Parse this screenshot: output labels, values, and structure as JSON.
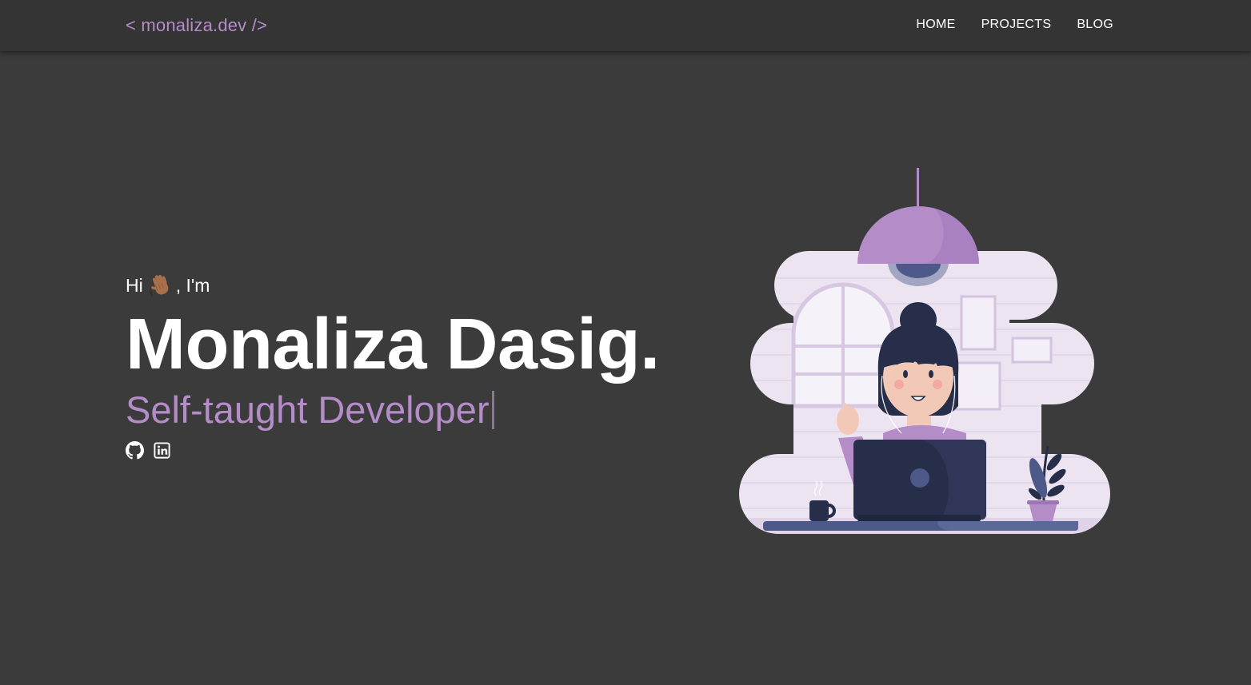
{
  "nav": {
    "brand": "< monaliza.dev />",
    "links": [
      "HOME",
      "PROJECTS",
      "BLOG"
    ]
  },
  "hero": {
    "greeting_prefix": "Hi",
    "greeting_suffix": ", I'm",
    "name": "Monaliza Dasig.",
    "subtitle": "Self-taught Developer"
  },
  "icons": {
    "wave": "waving-hand-emoji",
    "github": "github-icon",
    "linkedin": "linkedin-icon",
    "illustration": "developer-at-laptop-illustration"
  },
  "colors": {
    "background": "#3b3b3b",
    "navbar": "#343434",
    "accent": "#b48cc8",
    "text": "#ffffff"
  }
}
